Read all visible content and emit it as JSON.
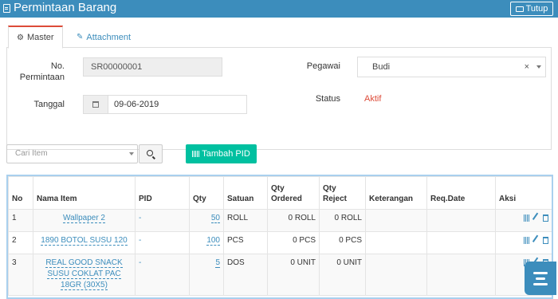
{
  "header": {
    "title": "Permintaan Barang",
    "close_label": "Tutup"
  },
  "tabs": [
    {
      "label": "Master"
    },
    {
      "label": "Attachment"
    }
  ],
  "master": {
    "no_label": "No. Permintaan",
    "no_value": "SR00000001",
    "tanggal_label": "Tanggal",
    "tanggal_value": "09-06-2019",
    "pegawai_label": "Pegawai",
    "pegawai_value": "Budi",
    "pegawai_clear": "×",
    "status_label": "Status",
    "status_value": "Aktif"
  },
  "toolbar": {
    "search_placeholder": "Cari Item",
    "add_pid_label": "Tambah PID"
  },
  "table": {
    "headers": [
      "No",
      "Nama Item",
      "PID",
      "Qty",
      "Satuan",
      "Qty Ordered",
      "Qty Reject",
      "Keterangan",
      "Req.Date",
      "Aksi"
    ],
    "rows": [
      {
        "no": "1",
        "nama": "Wallpaper 2",
        "pid": "-",
        "qty": "50",
        "satuan": "ROLL",
        "ordered": "0 ROLL",
        "reject": "0 ROLL",
        "keterangan": "",
        "reqdate": ""
      },
      {
        "no": "2",
        "nama": "1890 BOTOL SUSU 120",
        "pid": "-",
        "qty": "100",
        "satuan": "PCS",
        "ordered": "0 PCS",
        "reject": "0 PCS",
        "keterangan": "",
        "reqdate": ""
      },
      {
        "no": "3",
        "nama": "REAL GOOD SNACK SUSU COKLAT PAC 18GR (30X5)",
        "pid": "-",
        "qty": "5",
        "satuan": "DOS",
        "ordered": "0 UNIT",
        "reject": "0 UNIT",
        "keterangan": "",
        "reqdate": ""
      }
    ]
  },
  "colors": {
    "primary": "#3c8dbc",
    "teal": "#00c0a0",
    "danger": "#dd4b39"
  },
  "icons": [
    "document-icon",
    "folder-icon",
    "gears-icon",
    "paperclip-icon",
    "calendar-icon",
    "search-icon",
    "barcode-icon",
    "pencil-icon",
    "trash-icon",
    "menu-icon"
  ]
}
